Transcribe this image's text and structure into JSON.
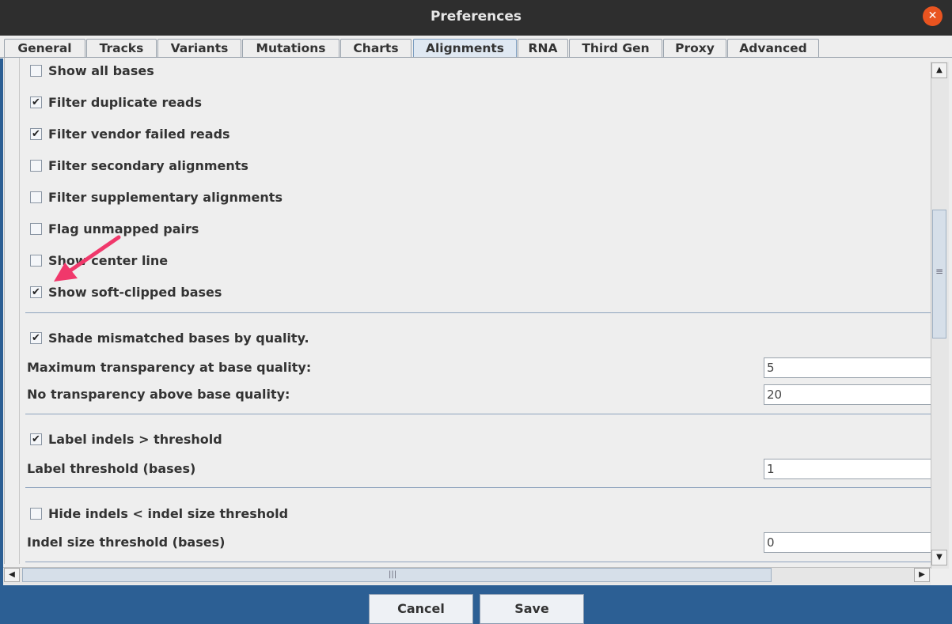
{
  "window": {
    "title": "Preferences"
  },
  "tabs": [
    {
      "label": "General"
    },
    {
      "label": "Tracks"
    },
    {
      "label": "Variants"
    },
    {
      "label": "Mutations"
    },
    {
      "label": "Charts"
    },
    {
      "label": "Alignments"
    },
    {
      "label": "RNA"
    },
    {
      "label": "Third Gen"
    },
    {
      "label": "Proxy"
    },
    {
      "label": "Advanced"
    }
  ],
  "active_tab": "Alignments",
  "checkboxes": [
    {
      "label": "Show all bases",
      "checked": false
    },
    {
      "label": "Filter duplicate reads",
      "checked": true
    },
    {
      "label": "Filter vendor failed reads",
      "checked": true
    },
    {
      "label": "Filter secondary alignments",
      "checked": false
    },
    {
      "label": "Filter supplementary alignments",
      "checked": false
    },
    {
      "label": "Flag unmapped pairs",
      "checked": false
    },
    {
      "label": "Show center line",
      "checked": false
    },
    {
      "label": "Show soft-clipped bases",
      "checked": true
    }
  ],
  "shade": {
    "checkbox": {
      "label": "Shade mismatched bases by quality.",
      "checked": true
    },
    "max_transparency_label": "Maximum transparency at base quality:",
    "max_transparency_value": "5",
    "no_transparency_label": "No transparency above base quality:",
    "no_transparency_value": "20"
  },
  "indels": {
    "label_checkbox": {
      "label": "Label indels >  threshold",
      "checked": true
    },
    "label_threshold_label": "Label threshold (bases)",
    "label_threshold_value": "1",
    "hide_checkbox": {
      "label": "Hide indels <  indel size threshold",
      "checked": false
    },
    "indel_size_label": "Indel size threshold (bases)",
    "indel_size_value": "0"
  },
  "buttons": {
    "cancel": "Cancel",
    "save": "Save"
  },
  "glyphs": {
    "check": "✔",
    "close": "✕",
    "up": "▲",
    "down": "▼",
    "left": "◀",
    "right": "▶",
    "grip_v": "≡",
    "grip_h": "|||"
  },
  "colors": {
    "titlebar": "#2e2e2e",
    "close_button": "#e95420",
    "footer": "#2c5f94",
    "annotation_arrow": "#f0386b"
  }
}
